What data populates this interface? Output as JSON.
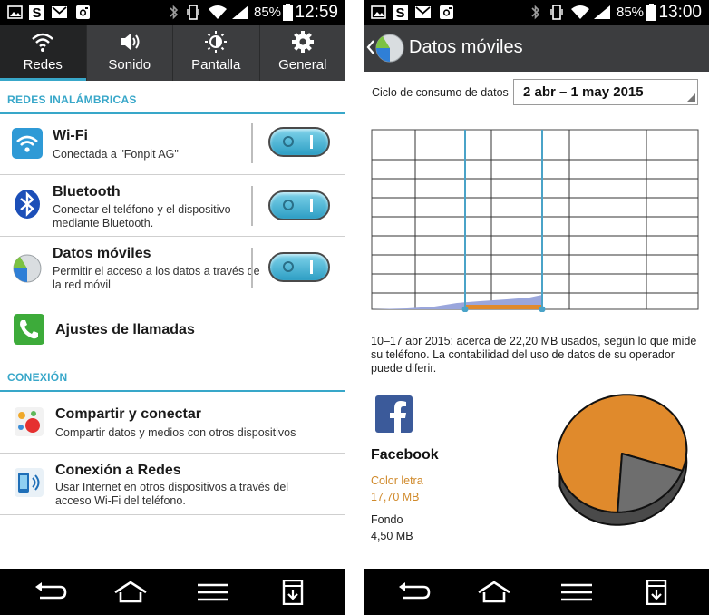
{
  "left_screen": {
    "status_bar": {
      "battery": "85%",
      "time": "12:59"
    },
    "tabs": [
      {
        "label": "Redes",
        "icon": "wifi-icon",
        "active": true
      },
      {
        "label": "Sonido",
        "icon": "speaker-icon",
        "active": false
      },
      {
        "label": "Pantalla",
        "icon": "brightness-icon",
        "active": false
      },
      {
        "label": "General",
        "icon": "gear-icon",
        "active": false
      }
    ],
    "section_wireless": "REDES INALÁMBRICAS",
    "items": [
      {
        "title": "Wi-Fi",
        "subtitle": "Conectada a \"Fonpit AG\"",
        "icon": "wifi-icon",
        "toggle": true
      },
      {
        "title": "Bluetooth",
        "subtitle": "Conectar el teléfono y el dispositivo mediante Bluetooth.",
        "icon": "bluetooth-icon",
        "toggle": true
      },
      {
        "title": "Datos móviles",
        "subtitle": "Permitir el acceso a los datos a través de la red móvil",
        "icon": "mobile-data-icon",
        "toggle": true
      },
      {
        "title": "Ajustes de llamadas",
        "icon": "phone-icon"
      }
    ],
    "section_connection": "CONEXIÓN",
    "connection_items": [
      {
        "title": "Compartir y conectar",
        "subtitle": "Compartir datos y medios con otros dispositivos",
        "icon": "share-connect-icon"
      },
      {
        "title": "Conexión a Redes",
        "subtitle": "Usar Internet en otros dispositivos a través del acceso Wi-Fi del teléfono.",
        "icon": "tethering-icon"
      }
    ]
  },
  "right_screen": {
    "status_bar": {
      "battery": "85%",
      "time": "13:00"
    },
    "header": {
      "title": "Datos móviles",
      "icon": "mobile-data-icon"
    },
    "cycle": {
      "label": "Ciclo de consumo de datos",
      "value": "2 abr – 1 may 2015"
    },
    "usage_chart": {
      "series": [
        {
          "kind": "total",
          "color": "#9aa6dc"
        },
        {
          "kind": "selection",
          "color": "#e08a2c"
        }
      ],
      "selection_markers": 2
    },
    "usage_text": "10–17 abr 2015: acerca de 22,20 MB usados, según lo que mide su teléfono. La contabilidad del uso de datos de su operador puede diferir.",
    "app": {
      "name": "Facebook",
      "icon": "facebook-icon",
      "foreground_label": "Color letra",
      "foreground_value": "17,70 MB",
      "background_label": "Fondo",
      "background_value": "4,50 MB"
    },
    "chart_data": {
      "type": "pie",
      "categories": [
        "Color letra",
        "Fondo"
      ],
      "values": [
        17.7,
        4.5
      ],
      "colors": [
        "#e08a2c",
        "#6e6e6e"
      ]
    }
  },
  "colors": {
    "accent": "#38a7c9",
    "bar": "#3c3d3f",
    "foreground": "#e08a2c",
    "background": "#6e6e6e"
  }
}
